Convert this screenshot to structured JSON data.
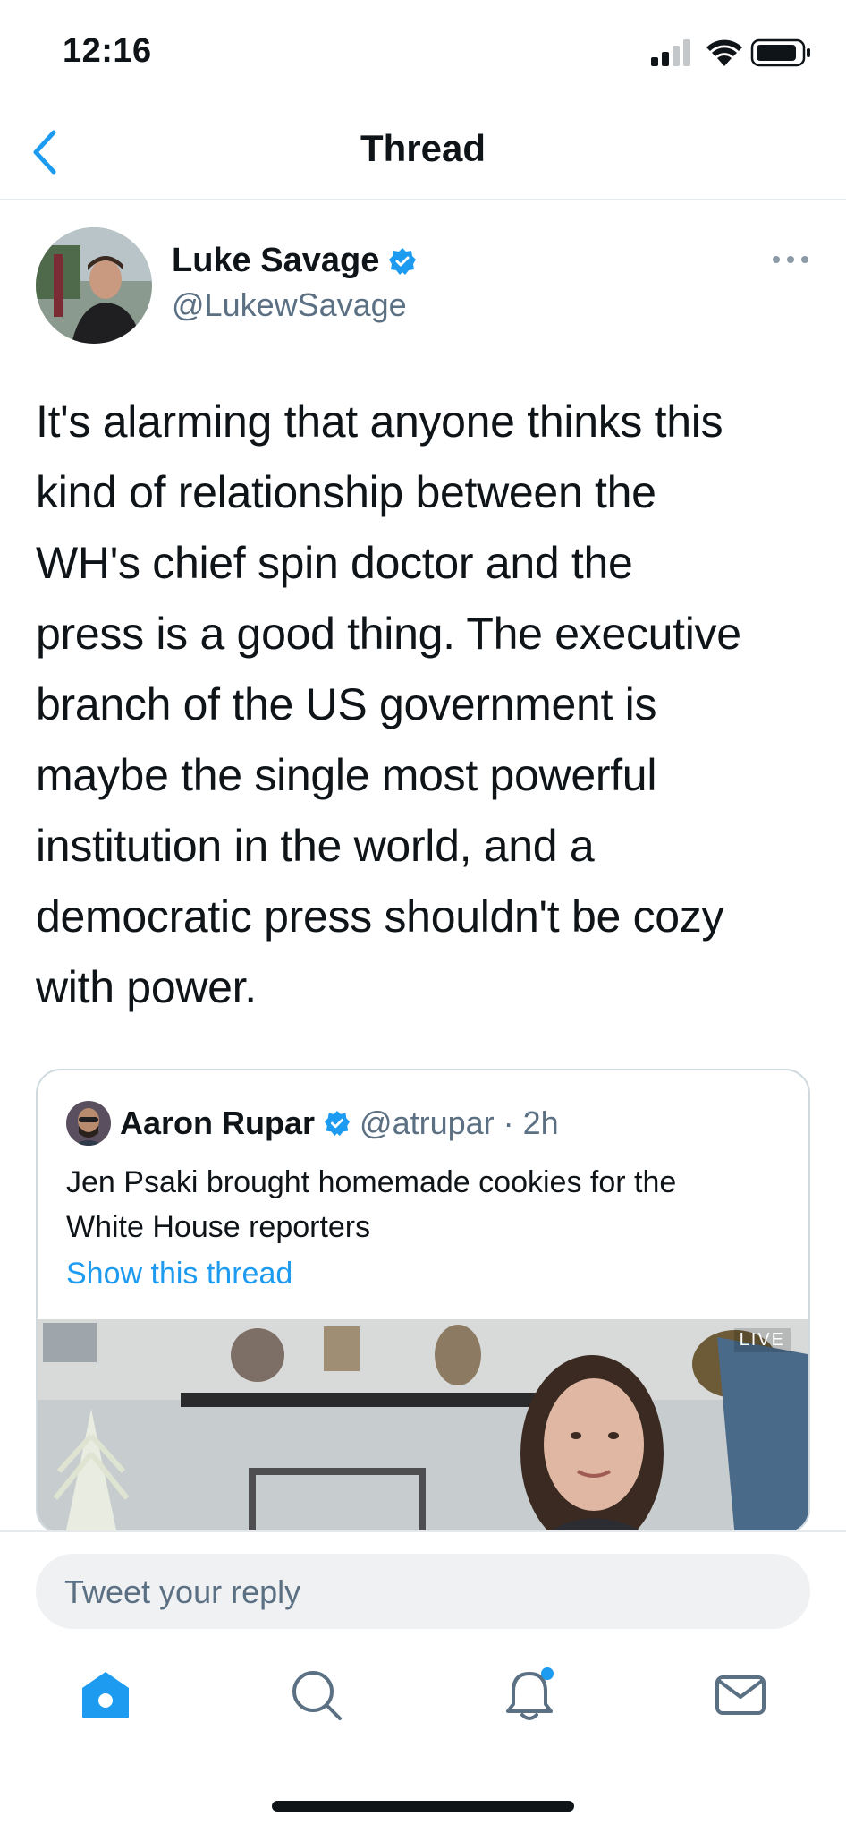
{
  "status_bar": {
    "time": "12:16"
  },
  "nav": {
    "title": "Thread"
  },
  "tweet": {
    "author_name": "Luke Savage",
    "author_handle": "@LukewSavage",
    "text_lines": [
      "It's alarming that anyone thinks this",
      "kind of relationship between the",
      "WH's chief spin doctor and the",
      "press is a good thing. The executive",
      "branch of the US government is",
      "maybe the single most powerful",
      "institution in the world, and a",
      "democratic press shouldn't be cozy",
      "with power."
    ]
  },
  "quote": {
    "author_name": "Aaron Rupar",
    "author_handle": "@atrupar",
    "time": "· 2h",
    "text_lines": [
      "Jen Psaki brought homemade cookies for the",
      "White House reporters"
    ],
    "show_thread": "Show this thread",
    "live_label": "LIVE"
  },
  "reply": {
    "placeholder": "Tweet your reply"
  },
  "tabs": [
    {
      "icon": "home-icon"
    },
    {
      "icon": "search-icon"
    },
    {
      "icon": "notifications-icon"
    },
    {
      "icon": "messages-icon"
    }
  ],
  "colors": {
    "accent": "#1d9bf0",
    "secondary_text": "#5b7083",
    "text": "#0f1419"
  }
}
